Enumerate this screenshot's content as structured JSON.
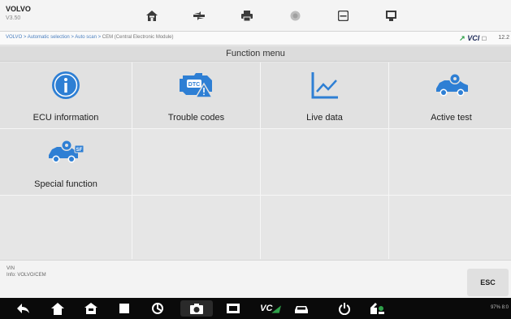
{
  "header": {
    "brand": "VOLVO",
    "version": "V3.50",
    "toolbar": [
      "home-icon",
      "vehicle-menu-icon",
      "print-icon",
      "help-icon",
      "save-icon",
      "data-logging-icon"
    ]
  },
  "breadcrumb": {
    "path": "VOLVO > Automatic selection > Auto scan > ",
    "current": "CEM (Central Electronic Module)"
  },
  "vci": {
    "label": "VCI",
    "battery": "12.2"
  },
  "function_menu": {
    "title": "Function menu",
    "items": [
      {
        "label": "ECU information",
        "icon": "info-icon",
        "color": "#2e7fd4"
      },
      {
        "label": "Trouble codes",
        "icon": "engine-dtc-icon",
        "color": "#2e7fd4"
      },
      {
        "label": "Live data",
        "icon": "line-chart-icon",
        "color": "#2e7fd4"
      },
      {
        "label": "Active test",
        "icon": "car-gear-icon",
        "color": "#2e7fd4"
      },
      {
        "label": "Special function",
        "icon": "car-special-icon",
        "color": "#2e7fd4"
      }
    ]
  },
  "vin_info": {
    "vin_label": "VIN",
    "info": "Info: VOLVO/CEM"
  },
  "esc_label": "ESC",
  "navbar": {
    "icons": [
      "back-icon",
      "home-icon",
      "car-home-icon",
      "recent-apps-icon",
      "browser-icon",
      "camera-icon",
      "display-icon",
      "vci-icon",
      "car-icon",
      "power-icon",
      "remote-icon"
    ],
    "status": "97% 8:0"
  }
}
